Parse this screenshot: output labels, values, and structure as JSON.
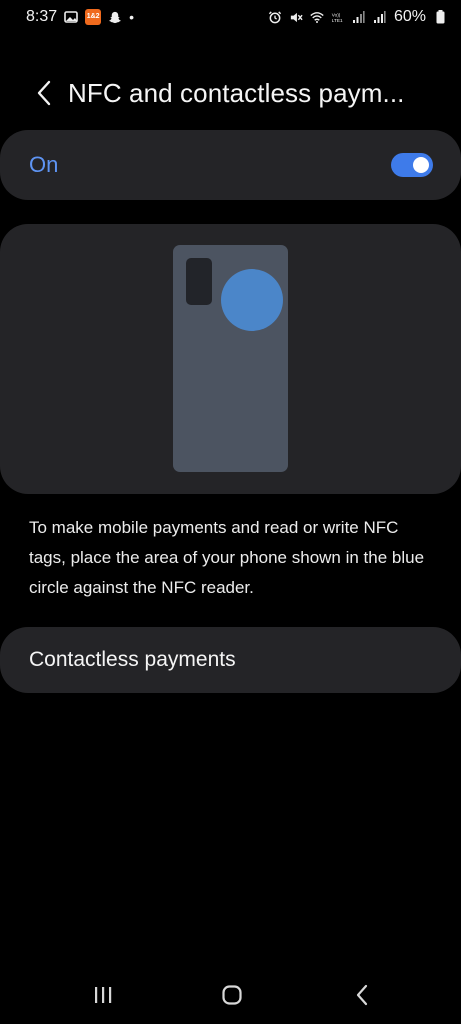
{
  "status_bar": {
    "time": "8:37",
    "app_badge_text": "1&2",
    "dot": "•",
    "battery_percent": "60%",
    "icons": [
      "image-icon",
      "app-badge-icon",
      "snapchat-icon",
      "alarm-icon",
      "mute-icon",
      "wifi-icon",
      "volte-icon",
      "signal-icon",
      "signal-icon",
      "battery-icon"
    ]
  },
  "header": {
    "title": "NFC and contactless paym..."
  },
  "toggle": {
    "label": "On",
    "state": true,
    "accent_color": "#3e7bea"
  },
  "illustration": {
    "phone_color": "#4c5461",
    "nfc_area_color": "#4b86c9"
  },
  "description": "To make mobile payments and read or write NFC tags, place the area of your phone shown in the blue circle against the NFC reader.",
  "menu": {
    "contactless_payments_label": "Contactless payments"
  },
  "nav_bar": {
    "icons": [
      "recent-apps-icon",
      "home-icon",
      "back-icon"
    ]
  }
}
